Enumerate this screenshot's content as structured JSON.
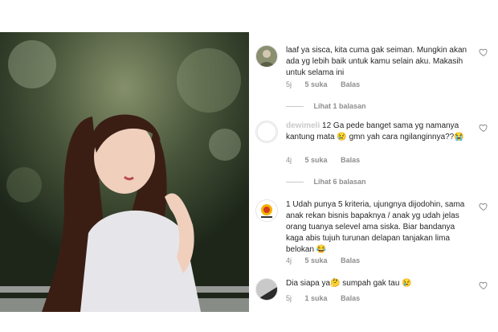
{
  "comments": [
    {
      "username": "",
      "text": "laaf ya sisca, kita cuma gak seiman. Mungkin akan ada yg lebih baik untuk kamu selain aku. Makasih untuk selama ini",
      "age": "5j",
      "likes": "5 suka",
      "reply_label": "Balas",
      "view_replies": "Lihat 1 balasan"
    },
    {
      "username": "dewimeli",
      "text": "12 Ga pede banget sama yg namanya kantung mata 😢 gmn yah cara ngilanginnya??😭",
      "age": "4j",
      "likes": "5 suka",
      "reply_label": "Balas",
      "view_replies": "Lihat 6 balasan"
    },
    {
      "username": "",
      "text": "1 Udah punya 5 kriteria, ujungnya dijodohin, sama anak rekan bisnis bapaknya / anak yg udah jelas orang tuanya selevel ama siska. Biar bandanya kaga abis tujuh turunan delapan tanjakan lima belokan 😂",
      "age": "4j",
      "likes": "5 suka",
      "reply_label": "Balas"
    },
    {
      "username": "",
      "text": "Dia siapa ya🤔 sumpah gak tau 😢",
      "age": "5j",
      "likes": "1 suka",
      "reply_label": "Balas"
    }
  ],
  "icons": {
    "heart": "heart-outline-icon"
  },
  "colors": {
    "text": "#262626",
    "meta": "#8e8e8e",
    "divider": "#c7c7c7"
  }
}
